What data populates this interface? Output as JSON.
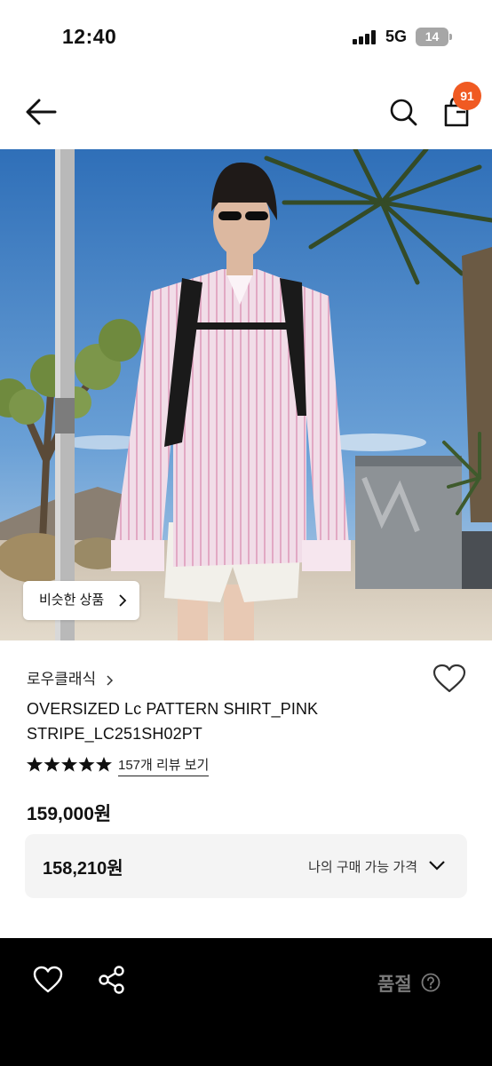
{
  "status_bar": {
    "time": "12:40",
    "network": "5G",
    "battery": "14"
  },
  "header": {
    "icons": [
      "back-arrow-icon",
      "search-icon",
      "shopping-bag-icon"
    ],
    "cart_count": "91",
    "badge_color": "#f05a22"
  },
  "hero": {
    "similar_button_label": "비슷한 상품"
  },
  "product": {
    "brand": "로우클래식",
    "name": "OVERSIZED Lc PATTERN SHIRT_PINK STRIPE_LC251SH02PT",
    "rating_stars": 5,
    "review_link": "157개 리뷰 보기",
    "price": "159,000원"
  },
  "my_price": {
    "value": "158,210원",
    "label": "나의 구매 가능 가격"
  },
  "bottom_bar": {
    "status_label": "품절",
    "icons": [
      "heart-icon",
      "share-icon",
      "help-icon"
    ]
  }
}
